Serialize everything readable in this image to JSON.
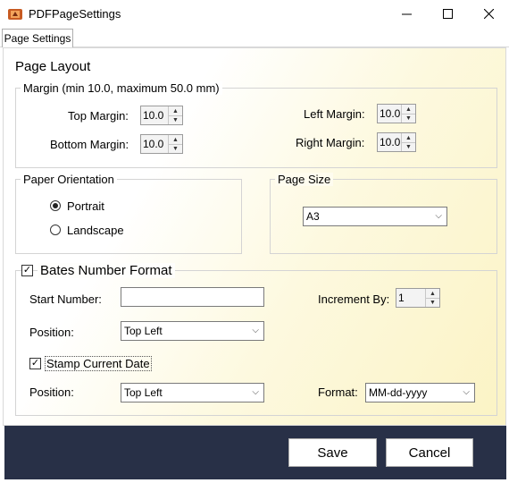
{
  "window": {
    "title": "PDFPageSettings"
  },
  "tab": {
    "label": "Page Settings"
  },
  "page_layout": {
    "heading": "Page Layout"
  },
  "margin": {
    "group_label": "Margin (min 10.0, maximum 50.0 mm)",
    "top_label": "Top Margin:",
    "top_value": "10.0",
    "bottom_label": "Bottom Margin:",
    "bottom_value": "10.0",
    "left_label": "Left Margin:",
    "left_value": "10.0",
    "right_label": "Right Margin:",
    "right_value": "10.0"
  },
  "orientation": {
    "group_label": "Paper Orientation",
    "portrait_label": "Portrait",
    "landscape_label": "Landscape",
    "selected": "Portrait"
  },
  "page_size": {
    "group_label": "Page Size",
    "selected": "A3"
  },
  "bates": {
    "label": "Bates Number Format",
    "checked": true,
    "start_label": "Start Number:",
    "start_value": "",
    "increment_label": "Increment By:",
    "increment_value": "1",
    "position_label": "Position:",
    "position_value": "Top Left",
    "stamp_label": "Stamp Current Date",
    "stamp_checked": true,
    "date_position_label": "Position:",
    "date_position_value": "Top Left",
    "format_label": "Format:",
    "format_value": "MM-dd-yyyy"
  },
  "buttons": {
    "save": "Save",
    "cancel": "Cancel"
  },
  "colors": {
    "footer": "#283047",
    "panel_gradient_end": "#fbf3c4"
  }
}
